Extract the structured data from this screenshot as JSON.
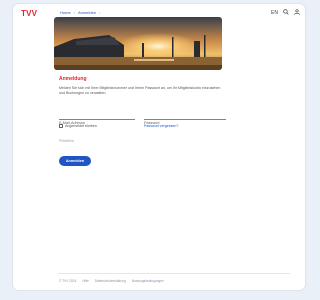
{
  "brand": {
    "name": "TVV"
  },
  "breadcrumb": [
    "Home",
    "Anmelden"
  ],
  "header": {
    "icons": [
      "user-icon",
      "search-icon",
      "gear-icon"
    ],
    "user_label": "EN"
  },
  "login": {
    "title": "Anmeldung",
    "description": "Melden Sie sich mit Ihrer Mitgliedsnummer und Ihrem Passwort an, um Ihr Mitgliedskonto einzusehen und Buchungen zu verwalten.",
    "email_placeholder": "E-Mail-Adresse",
    "password_placeholder": "Passwort",
    "remember_label": "Angemeldet bleiben",
    "forgot_label": "Passwort vergessen?",
    "hint": "Pflichtfeld",
    "submit_label": "Anmelden"
  },
  "footer": {
    "links": [
      "© TVV 2024",
      "Hilfe",
      "Datenschutzerklärung",
      "Nutzungsbedingungen"
    ]
  },
  "colors": {
    "accent": "#1f56c3",
    "brand_red": "#e8232f",
    "page_bg": "#eaf0f8"
  }
}
